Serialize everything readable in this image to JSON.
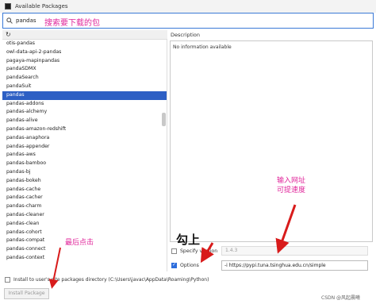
{
  "window": {
    "title": "Available Packages"
  },
  "search": {
    "value": "pandas"
  },
  "annotations": {
    "search_hint": "搜索要下载的包",
    "url_hint_line1": "输入网址",
    "url_hint_line2": "可提速度",
    "check_hint": "勾上",
    "install_hint": "最后点击"
  },
  "packages": [
    "otis-pandas",
    "owl-data-api-2-pandas",
    "pagaya-mapinpandas",
    "pandaSDMX",
    "pandaSearch",
    "pandaSuit",
    "pandas",
    "pandas-addons",
    "pandas-alchemy",
    "pandas-alive",
    "pandas-amazon-redshift",
    "pandas-anaphora",
    "pandas-appender",
    "pandas-aws",
    "pandas-bamboo",
    "pandas-bj",
    "pandas-bokeh",
    "pandas-cache",
    "pandas-cacher",
    "pandas-charm",
    "pandas-cleaner",
    "pandas-clean",
    "pandas-cohort",
    "pandas-compat",
    "pandas-connect",
    "pandas-context"
  ],
  "selected_index": 6,
  "description": {
    "label": "Description",
    "text": "No information available"
  },
  "specify_version": {
    "label": "Specify version",
    "checked": false,
    "value": "1.4.3"
  },
  "options": {
    "label": "Options",
    "checked": true,
    "value": "-i https://pypi.tuna.tsinghua.edu.cn/simple"
  },
  "site_packages": {
    "label": "Install to user's site packages directory (C:\\Users\\javac\\AppData\\Roaming\\Python)",
    "checked": false
  },
  "install_button": {
    "label": "Install Package"
  },
  "watermark": "CSDN @风起晨曦",
  "colors": {
    "accent": "#2d5fc4",
    "annotation": "#e0249a",
    "arrow": "#d81b1b"
  }
}
